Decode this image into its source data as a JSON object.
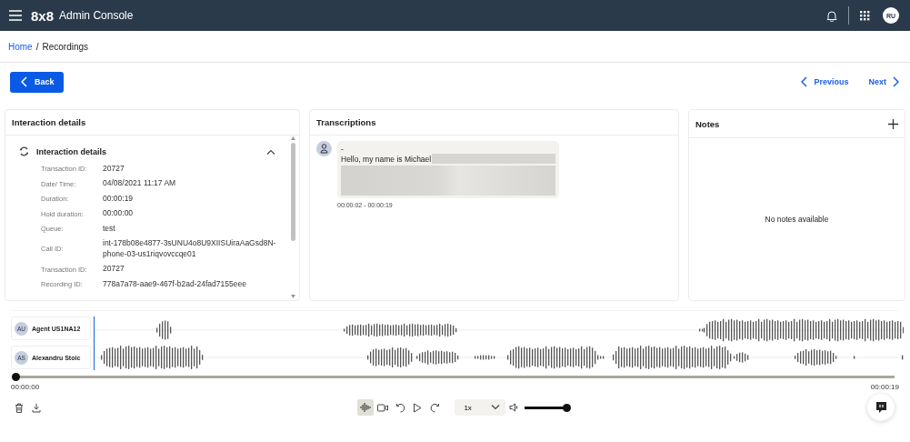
{
  "header": {
    "brand": "8x8",
    "title": "Admin Console",
    "avatar": "RU"
  },
  "breadcrumb": {
    "items": [
      "Home",
      "Recordings"
    ],
    "separator": "/"
  },
  "back": "Back",
  "pager": {
    "previous": "Previous",
    "next": "Next"
  },
  "interaction": {
    "title": "Interaction details",
    "section": {
      "title": "Interaction details",
      "expanded": true
    },
    "fields": [
      {
        "label": "Transaction ID:",
        "value": "20727"
      },
      {
        "label": "Date/ Time:",
        "value": "04/08/2021 11:17 AM"
      },
      {
        "label": "Duration:",
        "value": "00:00:19"
      },
      {
        "label": "Hold duration:",
        "value": "00:00:00"
      },
      {
        "label": "Queue:",
        "value": "test"
      },
      {
        "label": "Call ID:",
        "value": "int-178b08e4877-3sUNU4o8U9XIISUiraAaGsd8N-phone-03-us1riqvovccqe01"
      },
      {
        "label": "Transaction ID:",
        "value": "20727"
      },
      {
        "label": "Recording ID:",
        "value": "778a7a78-aae9-467f-b2ad-24fad7155eee"
      }
    ]
  },
  "transcriptions": {
    "title": "Transcriptions",
    "entries": [
      {
        "speaker": "-",
        "text": "Hello, my name is Michael",
        "time": "00:00:02 - 00:00:19"
      }
    ]
  },
  "notes": {
    "title": "Notes",
    "empty": "No notes available"
  },
  "player": {
    "tracks": [
      {
        "initials": "AU",
        "name": "Agent US1NA12"
      },
      {
        "initials": "AS",
        "name": "Alexandru Stoic"
      }
    ],
    "position": {
      "level": 0
    },
    "elapsed": "00:00:00",
    "total": "00:00:19",
    "waveform_view": {
      "selected": true
    },
    "speed": "1x",
    "volume": {
      "level": 1
    }
  }
}
